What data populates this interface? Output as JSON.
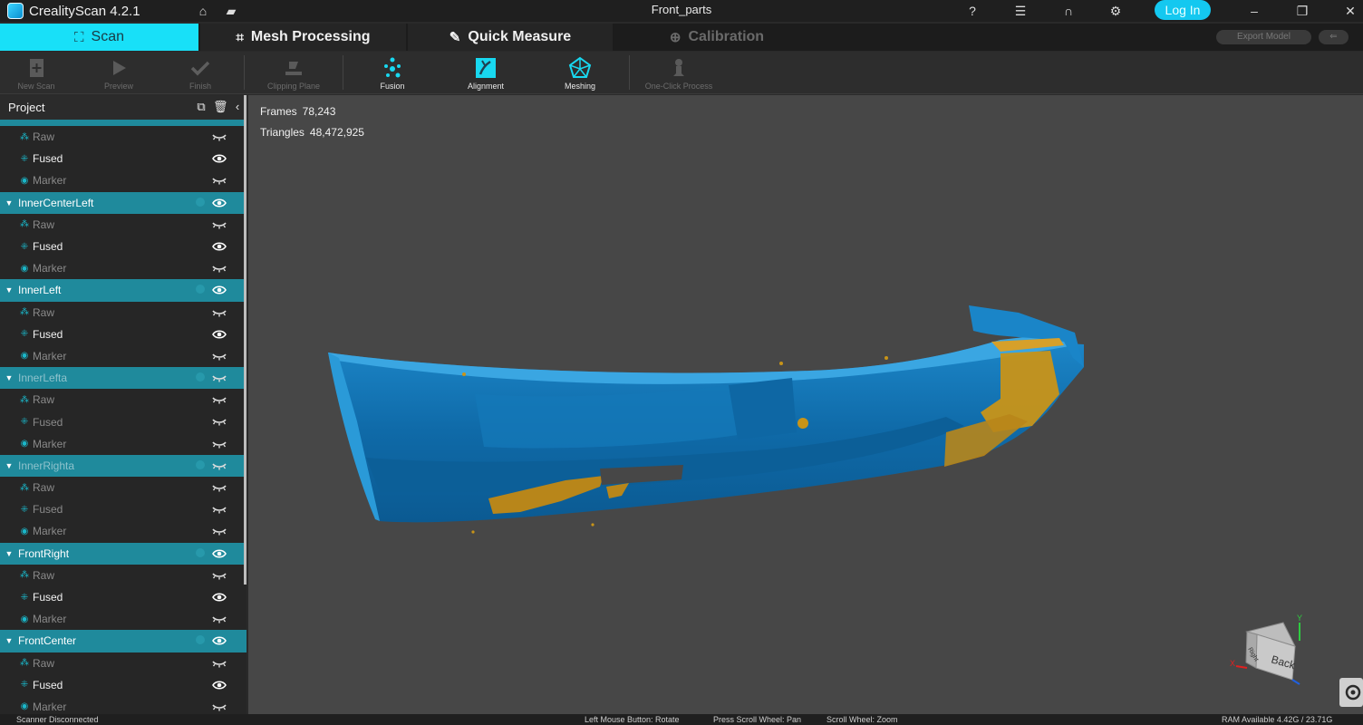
{
  "app": {
    "name": "CrealityScan 4.2.1",
    "doc_title": "Front_parts",
    "login_label": "Log In"
  },
  "title_icons": [
    "home-icon",
    "folder-icon",
    "help-icon",
    "notes-icon",
    "headset-icon",
    "settings-icon",
    "minimize-icon",
    "restore-icon",
    "close-icon"
  ],
  "mode_tabs": [
    {
      "label": "Scan",
      "icon": "scan-icon",
      "state": "active"
    },
    {
      "label": "Mesh Processing",
      "icon": "crop-icon",
      "state": "normal"
    },
    {
      "label": "Quick Measure",
      "icon": "ruler-icon",
      "state": "normal"
    },
    {
      "label": "Calibration",
      "icon": "target-icon",
      "state": "disabled"
    }
  ],
  "export_label": "Export Model",
  "toolbar": [
    {
      "label": "New Scan",
      "icon": "new-scan-icon",
      "enabled": false
    },
    {
      "label": "Preview",
      "icon": "preview-icon",
      "enabled": false
    },
    {
      "label": "Finish",
      "icon": "check-icon",
      "enabled": false
    },
    {
      "label": "Clipping Plane",
      "icon": "clipping-plane-icon",
      "enabled": false
    },
    {
      "label": "Fusion",
      "icon": "fusion-icon",
      "enabled": true
    },
    {
      "label": "Alignment",
      "icon": "alignment-icon",
      "enabled": true
    },
    {
      "label": "Meshing",
      "icon": "meshing-icon",
      "enabled": true
    },
    {
      "label": "One-Click Process",
      "icon": "one-click-icon",
      "enabled": false
    }
  ],
  "project": {
    "title": "Project",
    "rows": [
      {
        "type": "sub",
        "label": "Raw",
        "on": false
      },
      {
        "type": "sub",
        "label": "Fused",
        "on": true
      },
      {
        "type": "sub",
        "label": "Marker",
        "on": false
      },
      {
        "type": "group",
        "label": "InnerCenterLeft",
        "visible": true
      },
      {
        "type": "sub",
        "label": "Raw",
        "on": false
      },
      {
        "type": "sub",
        "label": "Fused",
        "on": true
      },
      {
        "type": "sub",
        "label": "Marker",
        "on": false
      },
      {
        "type": "group",
        "label": "InnerLeft",
        "visible": true
      },
      {
        "type": "sub",
        "label": "Raw",
        "on": false
      },
      {
        "type": "sub",
        "label": "Fused",
        "on": true
      },
      {
        "type": "sub",
        "label": "Marker",
        "on": false
      },
      {
        "type": "group",
        "label": "InnerLefta",
        "visible": false
      },
      {
        "type": "sub",
        "label": "Raw",
        "on": false
      },
      {
        "type": "sub",
        "label": "Fused",
        "on": false
      },
      {
        "type": "sub",
        "label": "Marker",
        "on": false
      },
      {
        "type": "group",
        "label": "InnerRighta",
        "visible": false
      },
      {
        "type": "sub",
        "label": "Raw",
        "on": false
      },
      {
        "type": "sub",
        "label": "Fused",
        "on": false
      },
      {
        "type": "sub",
        "label": "Marker",
        "on": false
      },
      {
        "type": "group",
        "label": "FrontRight",
        "visible": true
      },
      {
        "type": "sub",
        "label": "Raw",
        "on": false
      },
      {
        "type": "sub",
        "label": "Fused",
        "on": true
      },
      {
        "type": "sub",
        "label": "Marker",
        "on": false
      },
      {
        "type": "group",
        "label": "FrontCenter",
        "visible": true
      },
      {
        "type": "sub",
        "label": "Raw",
        "on": false
      },
      {
        "type": "sub",
        "label": "Fused",
        "on": true
      },
      {
        "type": "sub",
        "label": "Marker",
        "on": false
      }
    ]
  },
  "stats": {
    "frames_label": "Frames",
    "frames_value": "78,243",
    "triangles_label": "Triangles",
    "triangles_value": "48,472,925"
  },
  "viewcube": {
    "face_front": "Back",
    "face_side": "Right",
    "axis_x": "X",
    "axis_y": "Y"
  },
  "status": {
    "connection": "Scanner Disconnected",
    "hint_rotate": "Left Mouse Button: Rotate",
    "hint_pan": "Press Scroll Wheel: Pan",
    "hint_zoom": "Scroll Wheel: Zoom",
    "ram": "RAM Available 4.42G / 23.71G"
  },
  "colors": {
    "accent": "#18e0f8",
    "group_row": "#1f8a9c",
    "model_blue": "#0f6fb0",
    "model_gold": "#c89418"
  }
}
